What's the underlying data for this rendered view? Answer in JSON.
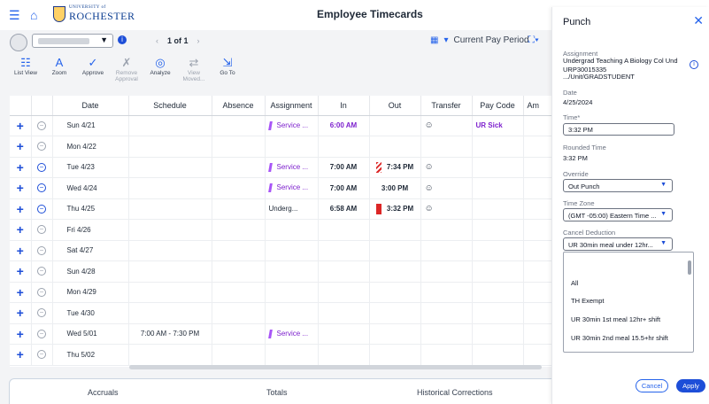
{
  "header": {
    "title": "Employee Timecards",
    "logo_small": "UNIVERSITY of",
    "logo_text": "ROCHESTER"
  },
  "pager": {
    "text": "1 of 1"
  },
  "pay_period": "Current Pay Period",
  "toolbar": [
    {
      "label": "List View",
      "icon": "list-icon",
      "enabled": true
    },
    {
      "label": "Zoom",
      "icon": "zoom-text-icon",
      "enabled": true
    },
    {
      "label": "Approve",
      "icon": "check-icon",
      "enabled": true
    },
    {
      "label": "Remove Approval",
      "icon": "remove-approval-icon",
      "enabled": false
    },
    {
      "label": "Analyze",
      "icon": "analyze-icon",
      "enabled": true
    },
    {
      "label": "View Moved...",
      "icon": "view-moved-icon",
      "enabled": false
    },
    {
      "label": "Go To",
      "icon": "goto-icon",
      "enabled": true
    }
  ],
  "grid": {
    "columns": [
      "Date",
      "Schedule",
      "Absence",
      "Assignment",
      "In",
      "Out",
      "Transfer",
      "Pay Code",
      "Am"
    ],
    "rows": [
      {
        "date": "Sun 4/21",
        "schedule": "",
        "absence": "",
        "assignment": "Service ...",
        "in": "6:00 AM",
        "out": "",
        "transfer": "",
        "paycode": "UR Sick"
      },
      {
        "date": "Mon 4/22",
        "schedule": "",
        "absence": "",
        "assignment": "",
        "in": "",
        "out": "",
        "transfer": "",
        "paycode": ""
      },
      {
        "date": "Tue 4/23",
        "schedule": "",
        "absence": "",
        "assignment": "Service ...",
        "in": "7:00 AM",
        "out": "7:34 PM",
        "transfer": "",
        "paycode": ""
      },
      {
        "date": "Wed 4/24",
        "schedule": "",
        "absence": "",
        "assignment": "Service ...",
        "in": "7:00 AM",
        "out": "3:00 PM",
        "transfer": "",
        "paycode": ""
      },
      {
        "date": "Thu 4/25",
        "schedule": "",
        "absence": "",
        "assignment": "Underg...",
        "in": "6:58 AM",
        "out": "3:32 PM",
        "transfer": "",
        "paycode": ""
      },
      {
        "date": "Fri 4/26",
        "schedule": "",
        "absence": "",
        "assignment": "",
        "in": "",
        "out": "",
        "transfer": "",
        "paycode": ""
      },
      {
        "date": "Sat 4/27",
        "schedule": "",
        "absence": "",
        "assignment": "",
        "in": "",
        "out": "",
        "transfer": "",
        "paycode": ""
      },
      {
        "date": "Sun 4/28",
        "schedule": "",
        "absence": "",
        "assignment": "",
        "in": "",
        "out": "",
        "transfer": "",
        "paycode": ""
      },
      {
        "date": "Mon 4/29",
        "schedule": "",
        "absence": "",
        "assignment": "",
        "in": "",
        "out": "",
        "transfer": "",
        "paycode": ""
      },
      {
        "date": "Tue 4/30",
        "schedule": "",
        "absence": "",
        "assignment": "",
        "in": "",
        "out": "",
        "transfer": "",
        "paycode": ""
      },
      {
        "date": "Wed 5/01",
        "schedule": "7:00 AM - 7:30 PM",
        "absence": "",
        "assignment": "Service ...",
        "in": "",
        "out": "",
        "transfer": "",
        "paycode": ""
      },
      {
        "date": "Thu 5/02",
        "schedule": "",
        "absence": "",
        "assignment": "",
        "in": "",
        "out": "",
        "transfer": "",
        "paycode": ""
      }
    ]
  },
  "bottom_tabs": [
    "Accruals",
    "Totals",
    "Historical Corrections"
  ],
  "panel": {
    "title": "Punch",
    "assignment_label": "Assignment",
    "assignment_line1": "Undergrad Teaching A Biology Col Und",
    "assignment_line2": "URP30015335",
    "assignment_line3": ".../Unit/GRADSTUDENT",
    "date_label": "Date",
    "date_value": "4/25/2024",
    "time_label": "Time*",
    "time_value": "3:32 PM",
    "rounded_label": "Rounded Time",
    "rounded_value": "3:32 PM",
    "override_label": "Override",
    "override_value": "Out Punch",
    "timezone_label": "Time Zone",
    "timezone_value": "(GMT -05:00) Eastern Time ...",
    "cancel_deduction_label": "Cancel Deduction",
    "cancel_deduction_value": "UR 30min meal under 12hr...",
    "options": [
      "All",
      "TH Exempt",
      "UR 30min 1st meal 12hr+ shift",
      "UR 30min 2nd meal 15.5+hr shift"
    ],
    "cancel_label": "Cancel",
    "apply_label": "Apply"
  }
}
